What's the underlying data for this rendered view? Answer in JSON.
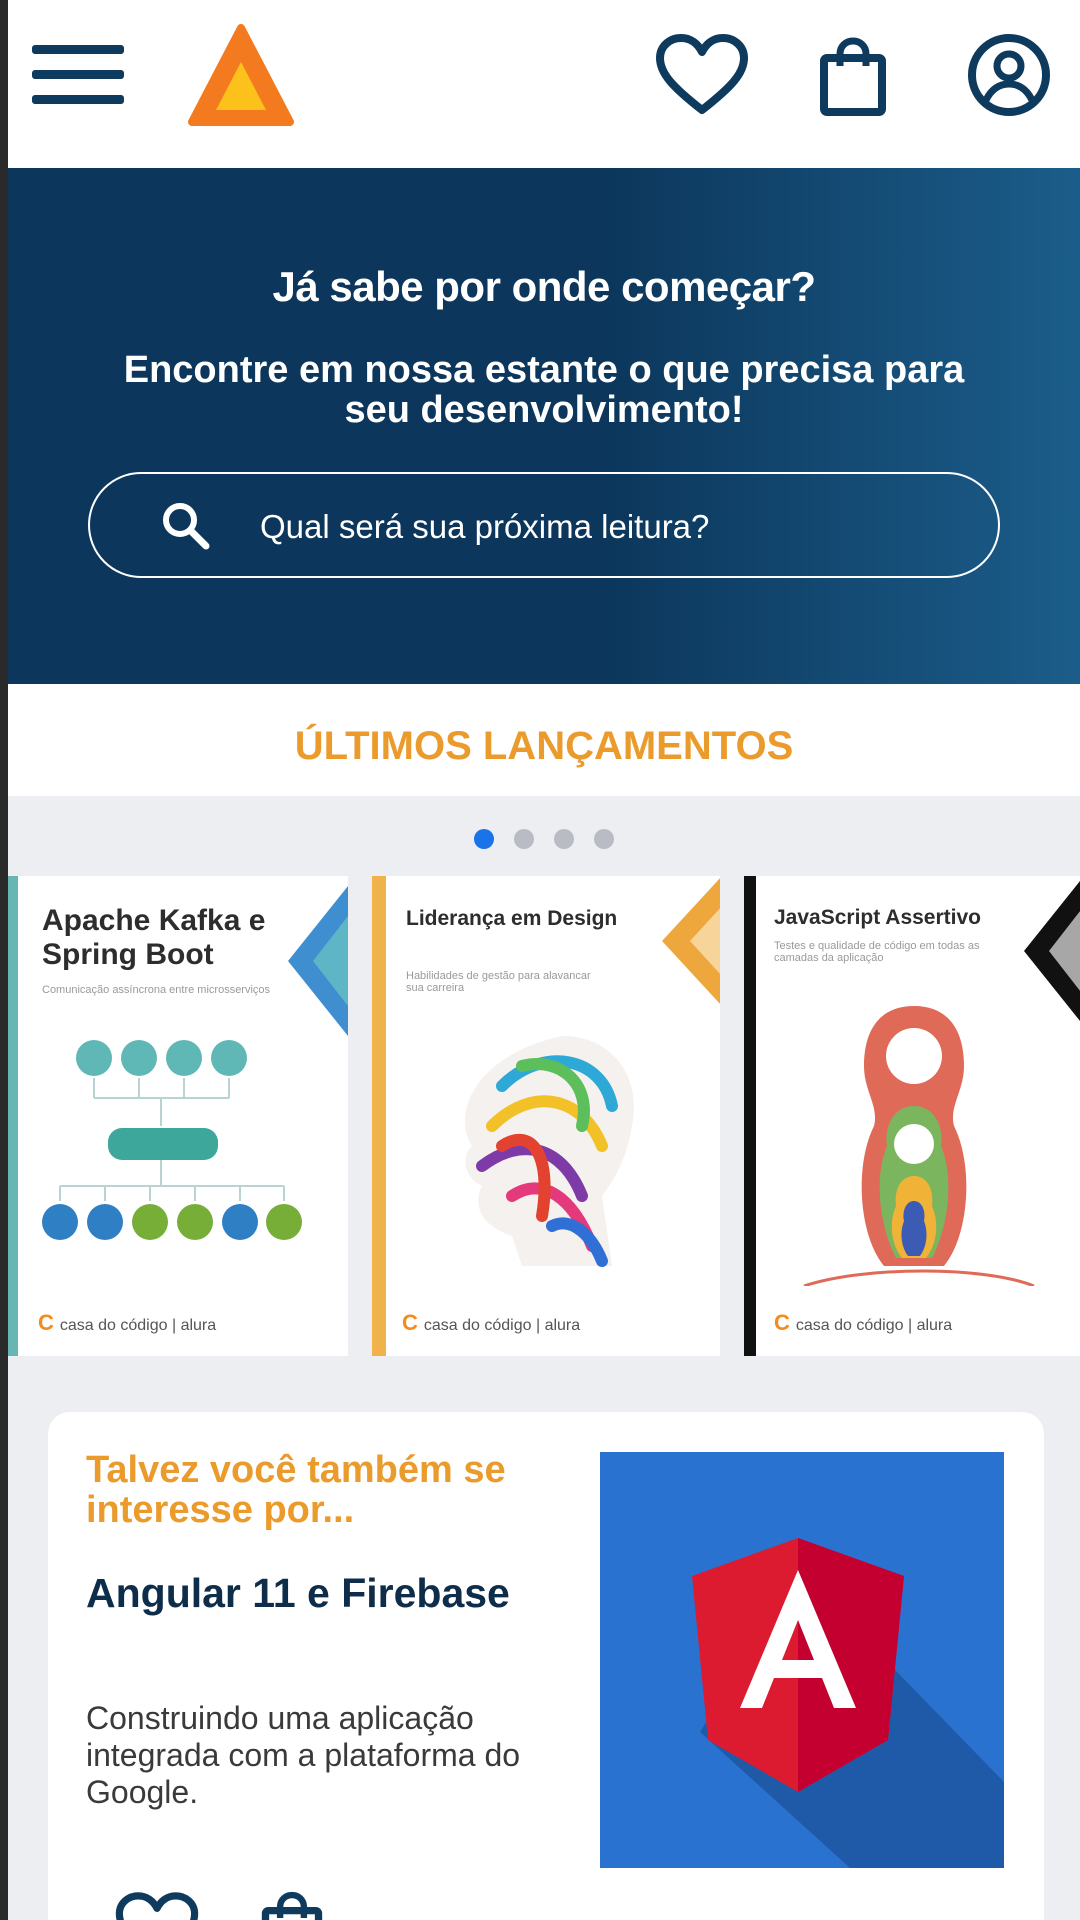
{
  "header": {
    "menu_icon": "hamburger-menu-icon",
    "logo_icon": "triangle-logo-icon",
    "actions": [
      "heart-icon",
      "shopping-bag-icon",
      "user-account-icon"
    ]
  },
  "hero": {
    "title": "Já sabe por onde começar?",
    "subtitle": "Encontre em nossa estante o que precisa para seu desenvolvimento!",
    "search_placeholder": "Qual será sua próxima leitura?"
  },
  "launches": {
    "title": "ÚLTIMOS LANÇAMENTOS",
    "carousel": {
      "pages": 4,
      "active_page": 1
    },
    "books": [
      {
        "title": "Apache Kafka e Spring Boot",
        "subtitle": "Comunicação assíncrona entre microsserviços",
        "publisher": "casa do código | alura"
      },
      {
        "title": "Liderança em Design",
        "subtitle": "Habilidades de gestão para alavancar sua carreira",
        "publisher": "casa do código | alura"
      },
      {
        "title": "JavaScript Assertivo",
        "subtitle": "Testes e qualidade de código em todas as camadas da aplicação",
        "publisher": "casa do código | alura"
      }
    ]
  },
  "suggestion": {
    "kicker": "Talvez você também se interesse por...",
    "title": "Angular 11 e Firebase",
    "description": "Construindo uma aplicação integrada com a plataforma do Google.",
    "image_icon": "angular-logo-icon",
    "actions": [
      "heart-icon",
      "shopping-bag-icon"
    ]
  },
  "colors": {
    "navy": "#0c365b",
    "orange": "#eb9b2b",
    "active_dot": "#1a73e8",
    "angular_red": "#dd1b30"
  }
}
